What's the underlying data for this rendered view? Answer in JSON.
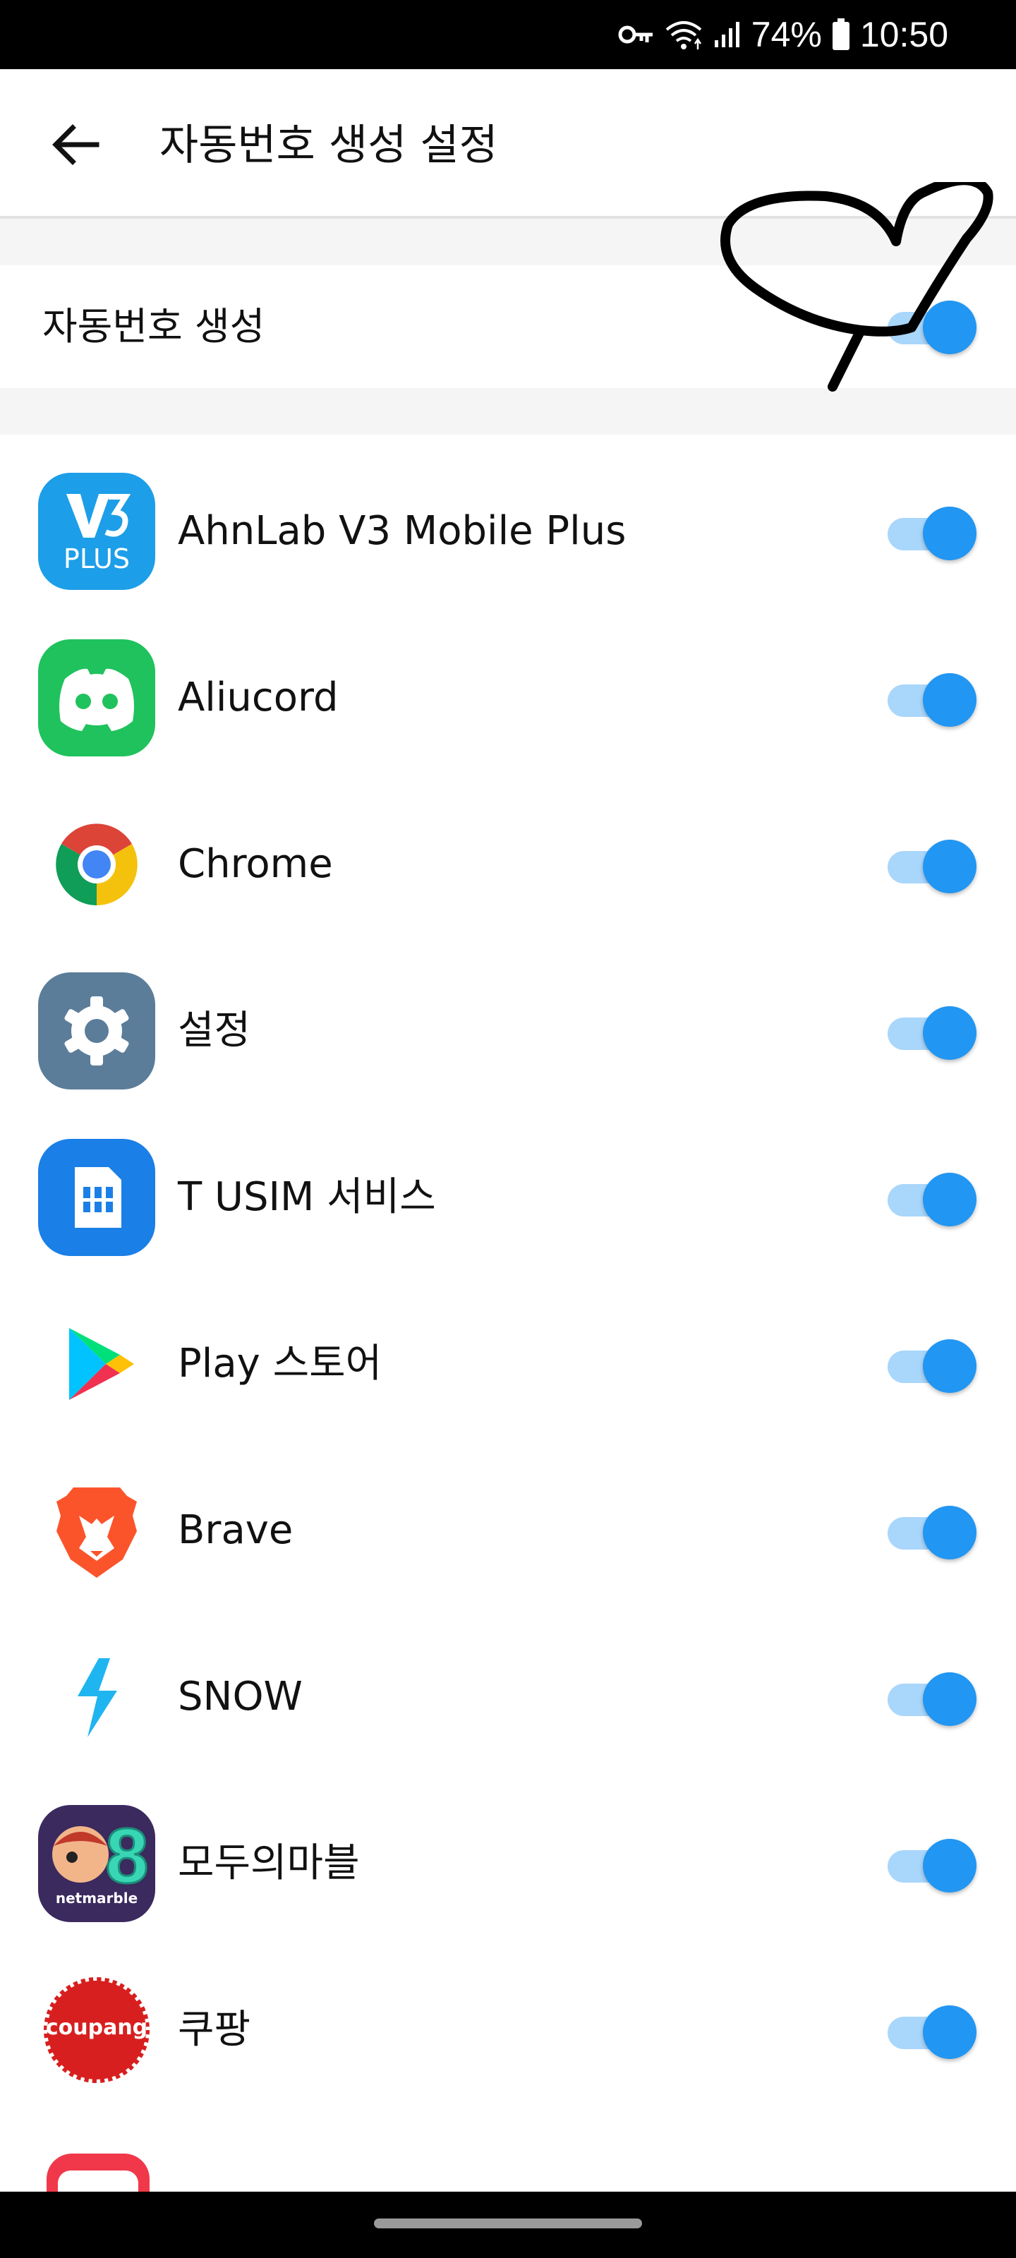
{
  "status": {
    "battery_pct": "74%",
    "time": "10:50"
  },
  "header": {
    "title": "자동번호 생성 설정",
    "back_icon": "back-arrow-icon"
  },
  "master": {
    "label": "자동번호 생성",
    "enabled": true
  },
  "colors": {
    "toggle_on": "#2196f3",
    "toggle_track": "#a9d6fb",
    "annotation": "#000000"
  },
  "apps": [
    {
      "name": "AhnLab V3 Mobile Plus",
      "icon": "ahnlab-v3-icon",
      "icon_text": "PLUS",
      "enabled": true
    },
    {
      "name": "Aliucord",
      "icon": "discord-icon",
      "enabled": true
    },
    {
      "name": "Chrome",
      "icon": "chrome-icon",
      "enabled": true
    },
    {
      "name": "설정",
      "icon": "settings-gear-icon",
      "enabled": true
    },
    {
      "name": "T USIM 서비스",
      "icon": "usim-icon",
      "enabled": true
    },
    {
      "name": "Play 스토어",
      "icon": "play-store-icon",
      "enabled": true
    },
    {
      "name": "Brave",
      "icon": "brave-lion-icon",
      "enabled": true
    },
    {
      "name": "SNOW",
      "icon": "snow-bolt-icon",
      "enabled": true
    },
    {
      "name": "모두의마블",
      "icon": "netmarble-game-icon",
      "icon_text": "netmarble",
      "enabled": true
    },
    {
      "name": "쿠팡",
      "icon": "coupang-icon",
      "icon_text": "coupang",
      "enabled": true
    }
  ]
}
